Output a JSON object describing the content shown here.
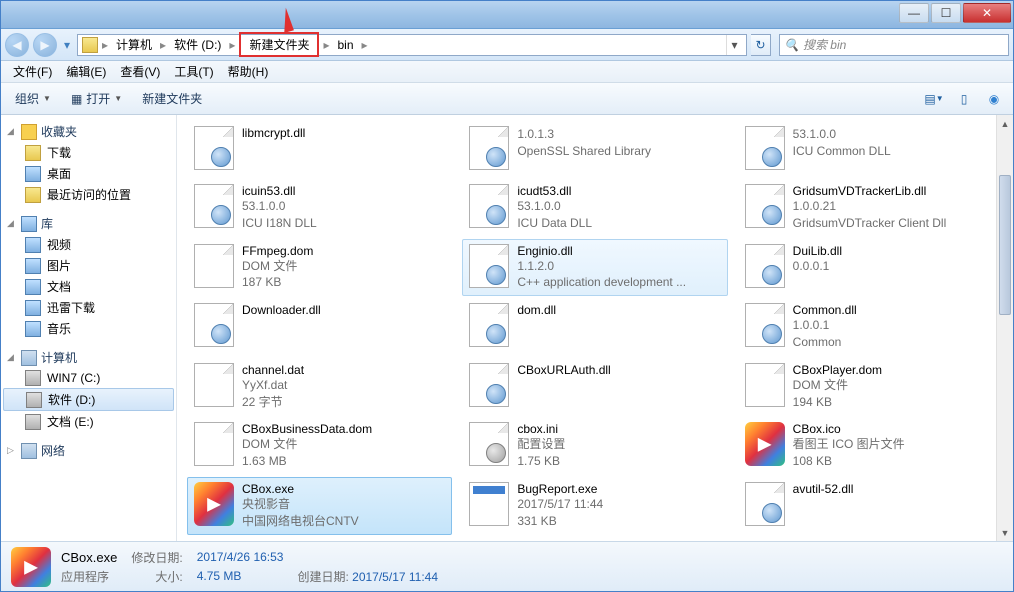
{
  "titlebar": {
    "min": "—",
    "max": "☐",
    "close": "✕"
  },
  "nav": {
    "back": "◀",
    "fwd": "▶",
    "drop": "▾",
    "refresh": "↻"
  },
  "breadcrumb": {
    "segments": [
      "计算机",
      "软件 (D:)",
      "新建文件夹",
      "bin"
    ],
    "highlight_index": 2
  },
  "search": {
    "placeholder": "搜索 bin",
    "icon": "🔍"
  },
  "menu": [
    "文件(F)",
    "编辑(E)",
    "查看(V)",
    "工具(T)",
    "帮助(H)"
  ],
  "toolbar": {
    "organize": "组织",
    "open": "打开",
    "newfolder": "新建文件夹"
  },
  "sidebar": {
    "favorites": {
      "label": "收藏夹",
      "items": [
        "下载",
        "桌面",
        "最近访问的位置"
      ]
    },
    "libraries": {
      "label": "库",
      "items": [
        "视频",
        "图片",
        "文档",
        "迅雷下载",
        "音乐"
      ]
    },
    "computer": {
      "label": "计算机",
      "items": [
        "WIN7 (C:)",
        "软件 (D:)",
        "文档 (E:)"
      ],
      "selected_index": 1
    },
    "network": {
      "label": "网络"
    }
  },
  "files": [
    {
      "name": "libmcrypt.dll",
      "line2": "",
      "line3": "",
      "icon": "dll"
    },
    {
      "name": "",
      "line2": "1.0.1.3",
      "line3": "OpenSSL Shared Library",
      "icon": "dll"
    },
    {
      "name": "",
      "line2": "53.1.0.0",
      "line3": "ICU Common DLL",
      "icon": "dll"
    },
    {
      "name": "icuin53.dll",
      "line2": "53.1.0.0",
      "line3": "ICU I18N DLL",
      "icon": "dll"
    },
    {
      "name": "icudt53.dll",
      "line2": "53.1.0.0",
      "line3": "ICU Data DLL",
      "icon": "dll"
    },
    {
      "name": "GridsumVDTrackerLib.dll",
      "line2": "1.0.0.21",
      "line3": "GridsumVDTracker Client Dll",
      "icon": "dll"
    },
    {
      "name": "FFmpeg.dom",
      "line2": "DOM 文件",
      "line3": "187 KB",
      "icon": "doc"
    },
    {
      "name": "Enginio.dll",
      "line2": "1.1.2.0",
      "line3": "C++ application development ...",
      "icon": "dll",
      "state": "hover"
    },
    {
      "name": "DuiLib.dll",
      "line2": "0.0.0.1",
      "line3": "",
      "icon": "dll"
    },
    {
      "name": "Downloader.dll",
      "line2": "",
      "line3": "",
      "icon": "dll"
    },
    {
      "name": "dom.dll",
      "line2": "",
      "line3": "",
      "icon": "dll"
    },
    {
      "name": "Common.dll",
      "line2": "1.0.0.1",
      "line3": "Common",
      "icon": "dll"
    },
    {
      "name": "channel.dat",
      "line2": "YyXf.dat",
      "line3": "22 字节",
      "icon": "doc"
    },
    {
      "name": "CBoxURLAuth.dll",
      "line2": "",
      "line3": "",
      "icon": "dll"
    },
    {
      "name": "CBoxPlayer.dom",
      "line2": "DOM 文件",
      "line3": "194 KB",
      "icon": "doc"
    },
    {
      "name": "CBoxBusinessData.dom",
      "line2": "DOM 文件",
      "line3": "1.63 MB",
      "icon": "doc"
    },
    {
      "name": "cbox.ini",
      "line2": "配置设置",
      "line3": "1.75 KB",
      "icon": "ini"
    },
    {
      "name": "CBox.ico",
      "line2": "看图王 ICO 图片文件",
      "line3": "108 KB",
      "icon": "exe"
    },
    {
      "name": "CBox.exe",
      "line2": "央视影音",
      "line3": "中国网络电视台CNTV",
      "icon": "exe",
      "state": "selected"
    },
    {
      "name": "BugReport.exe",
      "line2": "2017/5/17 11:44",
      "line3": "331 KB",
      "icon": "exe2"
    },
    {
      "name": "avutil-52.dll",
      "line2": "",
      "line3": "",
      "icon": "dll"
    }
  ],
  "status": {
    "name": "CBox.exe",
    "type": "应用程序",
    "mod_label": "修改日期:",
    "mod_value": "2017/4/26 16:53",
    "create_label": "创建日期:",
    "create_value": "2017/5/17 11:44",
    "size_label": "大小:",
    "size_value": "4.75 MB"
  }
}
